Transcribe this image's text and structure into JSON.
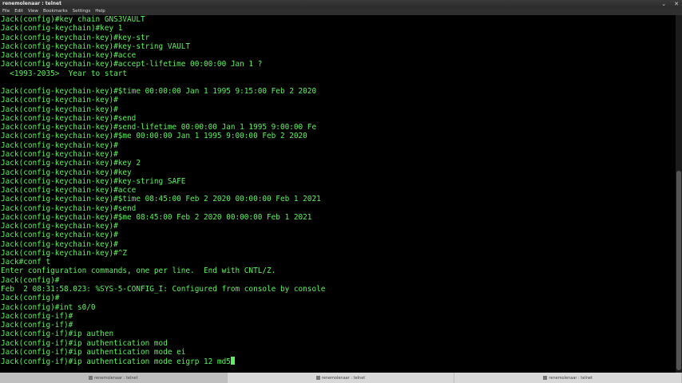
{
  "window": {
    "title": "renemolenaar : telnet",
    "controls": [
      "⌄",
      "✕"
    ]
  },
  "menu": [
    "File",
    "Edit",
    "View",
    "Bookmarks",
    "Settings",
    "Help"
  ],
  "terminal": {
    "lines": [
      "Jack(config)#key chain GNS3VAULT",
      "Jack(config-keychain)#key 1",
      "Jack(config-keychain-key)#key-str",
      "Jack(config-keychain-key)#key-string VAULT",
      "Jack(config-keychain-key)#acce",
      "Jack(config-keychain-key)#accept-lifetime 00:00:00 Jan 1 ?",
      "  <1993-2035>  Year to start",
      "",
      "Jack(config-keychain-key)#$time 00:00:00 Jan 1 1995 9:15:00 Feb 2 2020",
      "Jack(config-keychain-key)#",
      "Jack(config-keychain-key)#",
      "Jack(config-keychain-key)#send",
      "Jack(config-keychain-key)#send-lifetime 00:00:00 Jan 1 1995 9:00:00 Fe",
      "Jack(config-keychain-key)#$me 00:00:00 Jan 1 1995 9:00:00 Feb 2 2020",
      "Jack(config-keychain-key)#",
      "Jack(config-keychain-key)#",
      "Jack(config-keychain-key)#key 2",
      "Jack(config-keychain-key)#key",
      "Jack(config-keychain-key)#key-string SAFE",
      "Jack(config-keychain-key)#acce",
      "Jack(config-keychain-key)#$time 08:45:00 Feb 2 2020 00:00:00 Feb 1 2021",
      "Jack(config-keychain-key)#send",
      "Jack(config-keychain-key)#$me 08:45:00 Feb 2 2020 00:00:00 Feb 1 2021",
      "Jack(config-keychain-key)#",
      "Jack(config-keychain-key)#",
      "Jack(config-keychain-key)#",
      "Jack(config-keychain-key)#^Z",
      "Jack#conf t",
      "Enter configuration commands, one per line.  End with CNTL/Z.",
      "Jack(config)#",
      "Feb  2 08:31:58.023: %SYS-5-CONFIG_I: Configured from console by console",
      "Jack(config)#",
      "Jack(config)#int s0/0",
      "Jack(config-if)#",
      "Jack(config-if)#",
      "Jack(config-if)#ip authen",
      "Jack(config-if)#ip authentication mod",
      "Jack(config-if)#ip authentication mode ei",
      "Jack(config-if)#ip authentication mode eigrp 12 md5"
    ],
    "text_color": "#5cf25c",
    "background": "#000000"
  },
  "taskbar": {
    "tasks": [
      "renemolenaar : telnet",
      "renemolenaar : telnet",
      "renemolenaar : telnet"
    ]
  }
}
